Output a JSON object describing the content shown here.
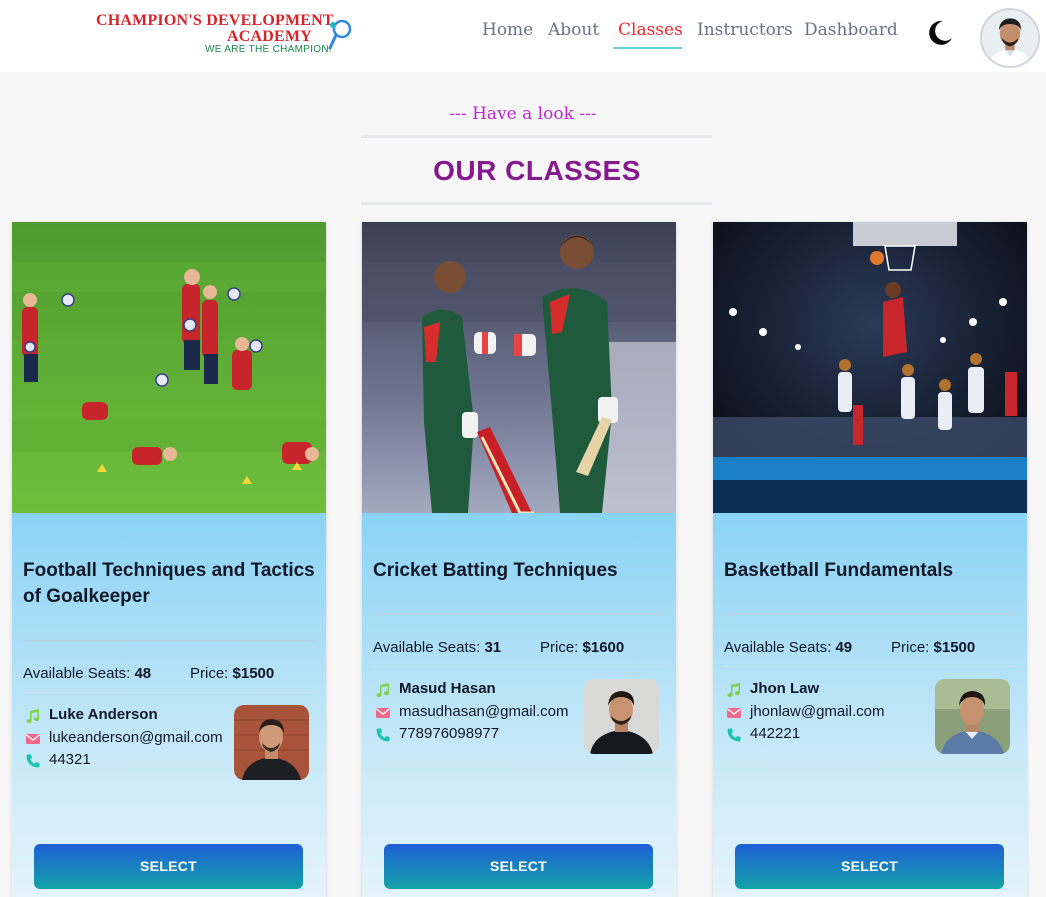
{
  "brand": {
    "name_line1": "CHAMPION'S DEVELOPMENT",
    "name_line2": "ACADEMY",
    "tagline": "WE ARE THE CHAMPION!"
  },
  "nav": {
    "items": [
      {
        "label": "Home"
      },
      {
        "label": "About"
      },
      {
        "label": "Classes",
        "active": true
      },
      {
        "label": "Instructors"
      },
      {
        "label": "Dashboard"
      }
    ],
    "theme_toggle_icon": "moon-icon"
  },
  "section": {
    "kicker": "--- Have a look ---",
    "title": "OUR CLASSES"
  },
  "labels": {
    "seats": "Available Seats:",
    "price": "Price:",
    "select": "SELECT"
  },
  "classes": [
    {
      "title": "Football Techniques and Tactics of Goalkeeper",
      "seats": "48",
      "price": "$1500",
      "instructor": {
        "name": "Luke Anderson",
        "email": "lukeanderson@gmail.com",
        "phone": "44321"
      }
    },
    {
      "title": "Cricket Batting Techniques",
      "seats": "31",
      "price": "$1600",
      "instructor": {
        "name": "Masud Hasan",
        "email": "masudhasan@gmail.com",
        "phone": "778976098977"
      }
    },
    {
      "title": "Basketball Fundamentals",
      "seats": "49",
      "price": "$1500",
      "instructor": {
        "name": "Jhon Law",
        "email": "jhonlaw@gmail.com",
        "phone": "442221"
      }
    }
  ],
  "colors": {
    "accent_purple": "#86198f",
    "kicker_magenta": "#c026d3",
    "active_nav": "#ef2a2a",
    "card_bg": "#8ad3f5",
    "button_gradient_top": "#1e5fd6",
    "button_gradient_bottom": "#14a3a8"
  }
}
